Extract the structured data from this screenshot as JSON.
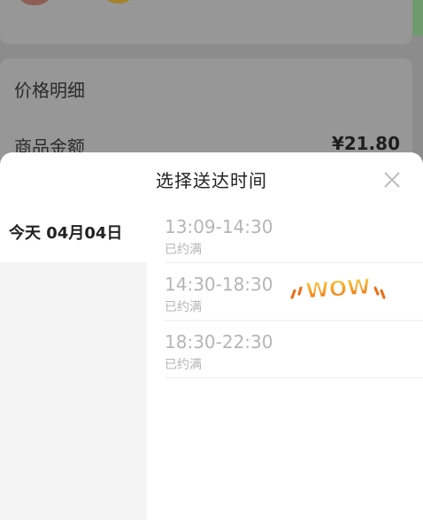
{
  "background": {
    "price_detail_label": "价格明细",
    "product_amount_label": "商品金额",
    "product_amount_value": "¥21.80"
  },
  "sheet": {
    "title": "选择送达时间",
    "close_icon": "close-icon",
    "dates": [
      {
        "label": "今天 04月04日",
        "selected": true
      }
    ],
    "slots": [
      {
        "time": "13:09-14:30",
        "status": "已约满"
      },
      {
        "time": "14:30-18:30",
        "status": "已约满"
      },
      {
        "time": "18:30-22:30",
        "status": "已约满"
      }
    ]
  },
  "sticker": {
    "text": "WOW"
  },
  "colors": {
    "overlay": "#8c8c8c",
    "sheet_bg": "#ffffff",
    "date_column_bg": "#f4f4f4",
    "disabled_text": "#b5b5b5",
    "sticker_orange": "#f08a1c"
  }
}
